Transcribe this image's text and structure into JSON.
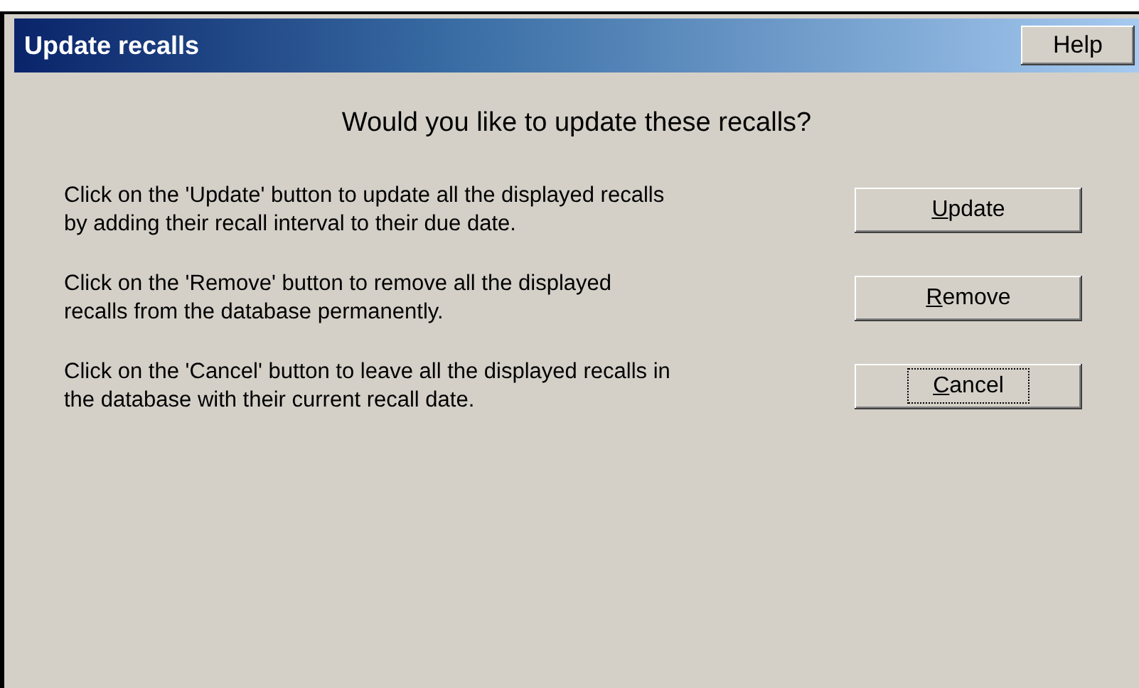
{
  "window": {
    "title": "Update recalls",
    "help_button": "Help"
  },
  "question": "Would you like to update these recalls?",
  "actions": [
    {
      "description": "Click on the 'Update' button to update all the displayed recalls by adding their recall interval to their due date.",
      "button": "Update",
      "mnemonic_underlined": true,
      "focused": false
    },
    {
      "description": "Click on the 'Remove' button to remove all the displayed recalls from the database permanently.",
      "button": "Remove",
      "mnemonic_underlined": true,
      "focused": false
    },
    {
      "description": "Click on the 'Cancel' button to leave all the displayed recalls in the database with their current recall date.",
      "button": "Cancel",
      "mnemonic_underlined": true,
      "focused": true
    }
  ]
}
